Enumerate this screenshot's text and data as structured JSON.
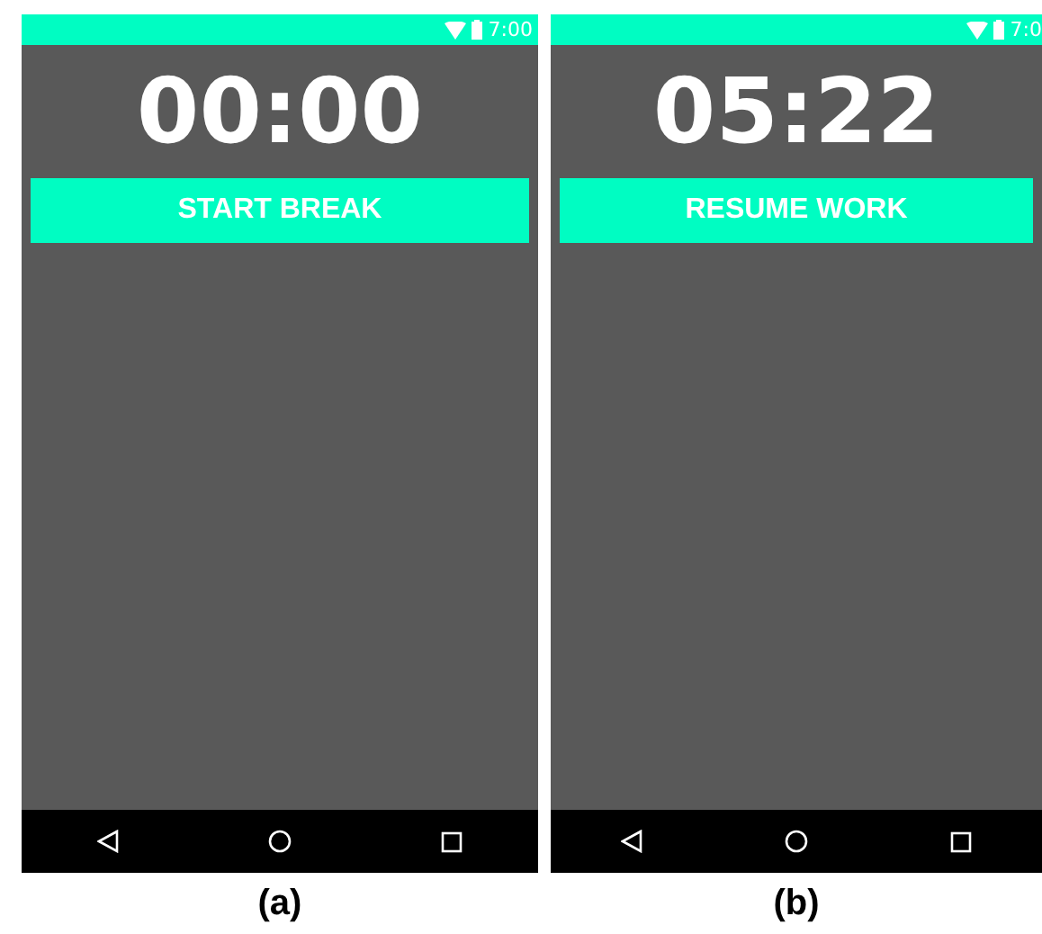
{
  "screens": [
    {
      "status_bar": {
        "time": "7:00"
      },
      "timer": "00:00",
      "button": "START BREAK",
      "caption": "(a)"
    },
    {
      "status_bar": {
        "time": "7:0"
      },
      "timer": "05:22",
      "button": "RESUME WORK",
      "caption": "(b)"
    }
  ]
}
